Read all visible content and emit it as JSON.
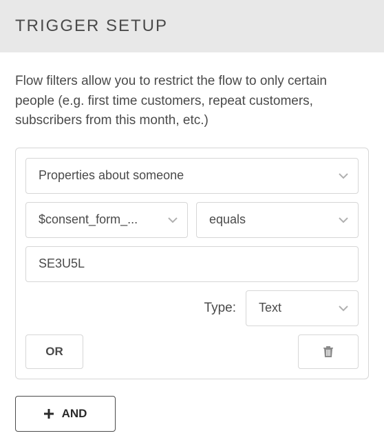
{
  "header": {
    "title": "TRIGGER SETUP"
  },
  "description": "Flow filters allow you to restrict the flow to only certain people (e.g. first time customers, repeat customers, subscribers from this month, etc.)",
  "filter": {
    "property_scope": "Properties about someone",
    "field_name": "$consent_form_...",
    "operator": "equals",
    "value": "SE3U5L",
    "type_label": "Type:",
    "type_value": "Text",
    "or_label": "OR"
  },
  "and_button": {
    "label": "AND"
  },
  "icons": {
    "chevron_down": "chevron-down-icon",
    "trash": "trash-icon",
    "plus": "plus-icon"
  },
  "colors": {
    "header_bg": "#e8e8e8",
    "border": "#d6d6d6",
    "text": "#4a4a4a"
  }
}
